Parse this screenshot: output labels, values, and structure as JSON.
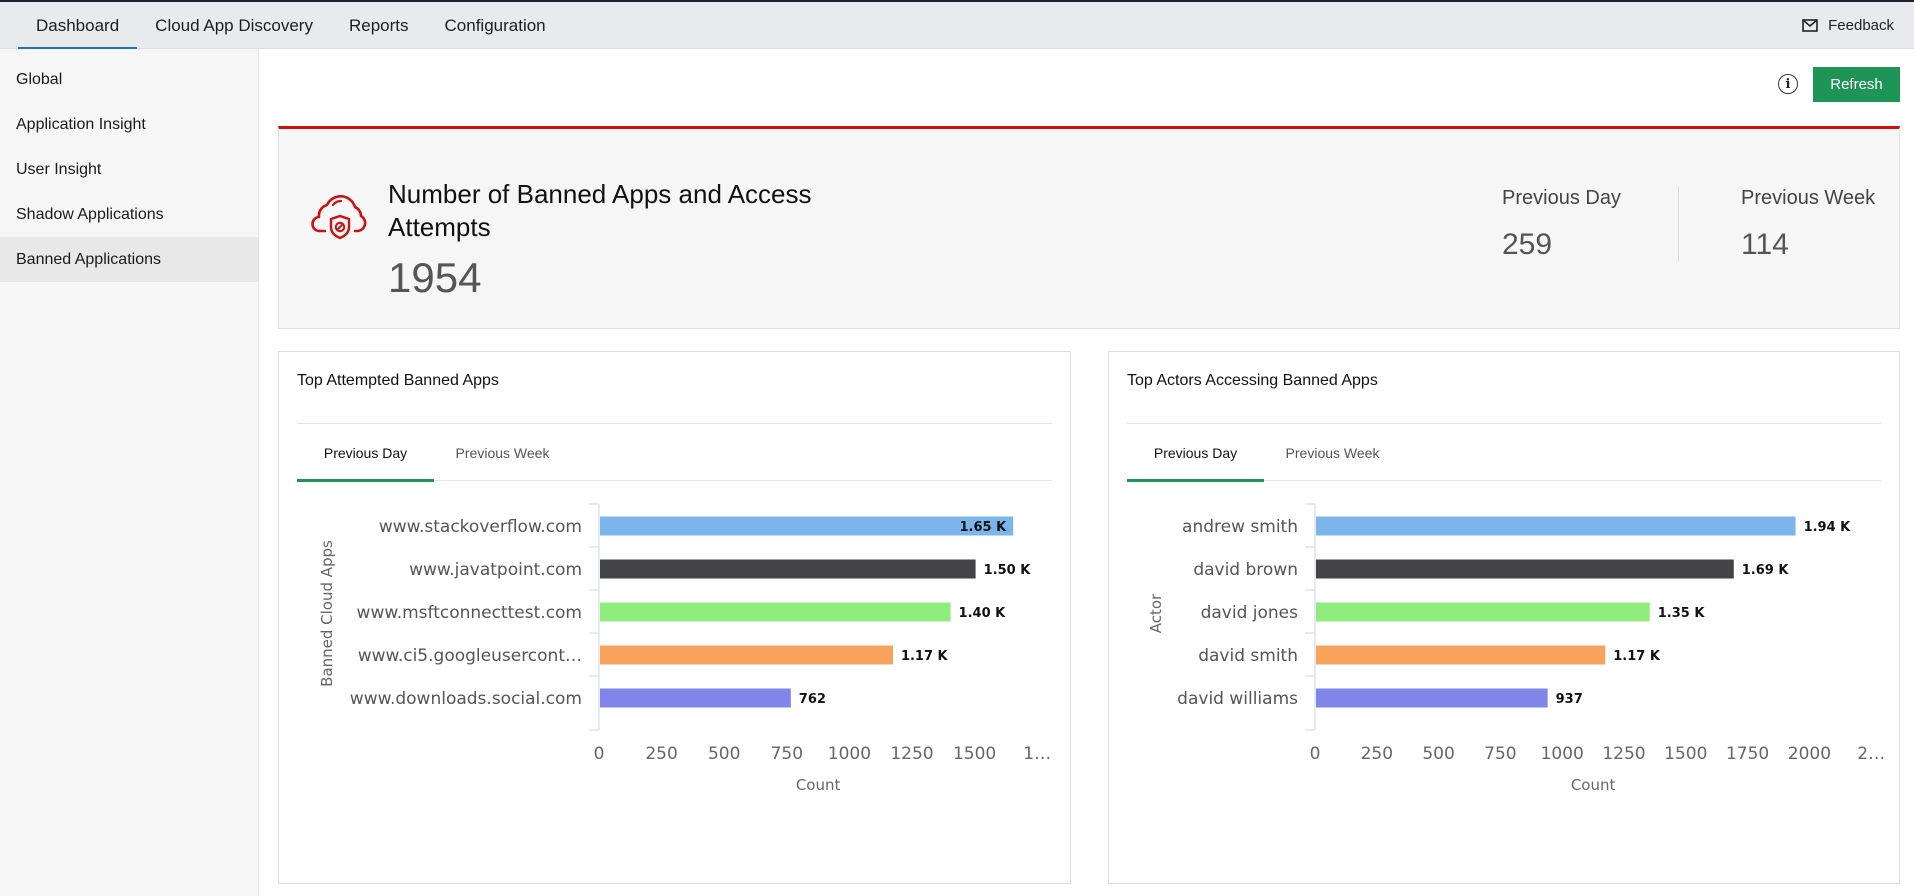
{
  "topnav": {
    "tabs": [
      {
        "label": "Dashboard",
        "active": true
      },
      {
        "label": "Cloud App Discovery",
        "active": false
      },
      {
        "label": "Reports",
        "active": false
      },
      {
        "label": "Configuration",
        "active": false
      }
    ],
    "feedback_label": "Feedback",
    "feedback_icon": "mail-icon"
  },
  "sidebar": {
    "items": [
      {
        "label": "Global",
        "active": false
      },
      {
        "label": "Application Insight",
        "active": false
      },
      {
        "label": "User Insight",
        "active": false
      },
      {
        "label": "Shadow Applications",
        "active": false
      },
      {
        "label": "Banned Applications",
        "active": true
      }
    ]
  },
  "toolbar": {
    "info_icon": "info-icon",
    "info_glyph": "i",
    "refresh_label": "Refresh"
  },
  "summary": {
    "icon": "cloud-shield-ban-icon",
    "title": "Number of Banned Apps and Access Attempts",
    "total": "1954",
    "stats": [
      {
        "label": "Previous Day",
        "value": "259"
      },
      {
        "label": "Previous Week",
        "value": "114"
      }
    ]
  },
  "colors": {
    "accent_green": "#1e9457",
    "accent_red": "#cc1111",
    "nav_blue": "#1a73c8",
    "bar_colors": [
      "#7cb5ec",
      "#434348",
      "#90ed7d",
      "#f7a35c",
      "#8085e9"
    ]
  },
  "panels": [
    {
      "title": "Top Attempted Banned Apps",
      "tabs": [
        {
          "label": "Previous Day",
          "active": true
        },
        {
          "label": "Previous Week",
          "active": false
        }
      ]
    },
    {
      "title": "Top Actors Accessing Banned Apps",
      "tabs": [
        {
          "label": "Previous Day",
          "active": true
        },
        {
          "label": "Previous Week",
          "active": false
        }
      ]
    }
  ],
  "chart_data": [
    {
      "type": "bar",
      "orientation": "horizontal",
      "title": "Top Attempted Banned Apps",
      "categories": [
        "www.stackoverflow.com",
        "www.javatpoint.com",
        "www.msftconnecttest.com",
        "www.ci5.googleusercont…",
        "www.downloads.social.com"
      ],
      "values": [
        1650,
        1500,
        1400,
        1170,
        762
      ],
      "data_labels": [
        "1.65 K",
        "1.50 K",
        "1.40 K",
        "1.17 K",
        "762"
      ],
      "xlabel": "Count",
      "ylabel": "Banned Cloud Apps",
      "x_ticks": [
        "0",
        "250",
        "500",
        "750",
        "1000",
        "1250",
        "1500",
        "1…"
      ],
      "xlim": [
        0,
        1750
      ],
      "grid": false,
      "legend": "none"
    },
    {
      "type": "bar",
      "orientation": "horizontal",
      "title": "Top Actors Accessing Banned Apps",
      "categories": [
        "andrew smith",
        "david brown",
        "david jones",
        "david smith",
        "david williams"
      ],
      "values": [
        1940,
        1690,
        1350,
        1170,
        937
      ],
      "data_labels": [
        "1.94 K",
        "1.69 K",
        "1.35 K",
        "1.17 K",
        "937"
      ],
      "xlabel": "Count",
      "ylabel": "Actor",
      "x_ticks": [
        "0",
        "250",
        "500",
        "750",
        "1000",
        "1250",
        "1500",
        "1750",
        "2000",
        "2…"
      ],
      "xlim": [
        0,
        2250
      ],
      "grid": false,
      "legend": "none"
    }
  ]
}
